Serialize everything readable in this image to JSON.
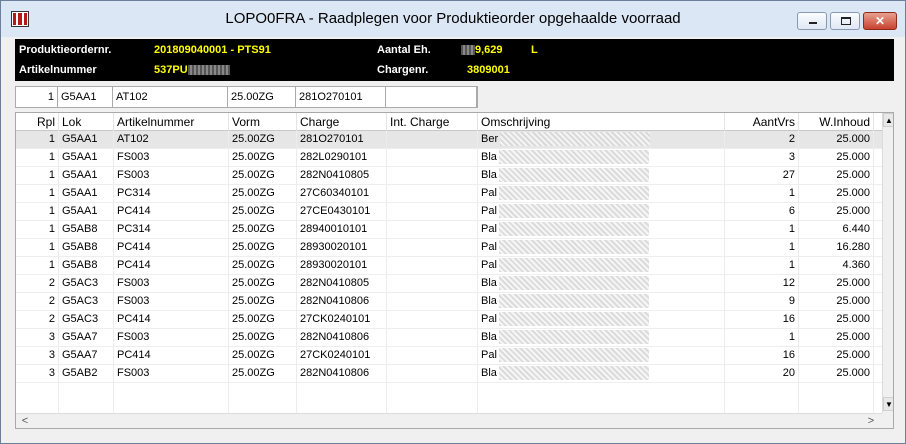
{
  "window": {
    "title": "LOPO0FRA - Raadplegen voor Produktieorder opgehaalde voorraad",
    "min_glyph": "",
    "max_glyph": "",
    "close_glyph": "✕"
  },
  "header": {
    "order_label": "Produktieordernr.",
    "order_value": "201809040001 - PTS91",
    "article_label": "Artikelnummer",
    "article_value": "537PU",
    "qty_label": "Aantal Eh.",
    "qty_value": "9,629",
    "qty_unit": "L",
    "batch_label": "Chargenr.",
    "batch_value": "3809001"
  },
  "selection": {
    "rpl": "1",
    "lok": "G5AA1",
    "artikel": "AT102",
    "vorm": "25.00ZG",
    "charge": "281O270101",
    "extra": ""
  },
  "table": {
    "headers": [
      "Rpl",
      "Lok",
      "Artikelnummer",
      "Vorm",
      "Charge",
      "Int. Charge",
      "Omschrijving",
      "AantVrs",
      "W.Inhoud"
    ],
    "rows": [
      {
        "rpl": "1",
        "lok": "G5AA1",
        "artikel": "AT102",
        "vorm": "25.00ZG",
        "charge": "281O270101",
        "int": "",
        "oms": "Ber",
        "aant": "2",
        "inh": "25.000"
      },
      {
        "rpl": "1",
        "lok": "G5AA1",
        "artikel": "FS003",
        "vorm": "25.00ZG",
        "charge": "282L0290101",
        "int": "",
        "oms": "Bla",
        "aant": "3",
        "inh": "25.000"
      },
      {
        "rpl": "1",
        "lok": "G5AA1",
        "artikel": "FS003",
        "vorm": "25.00ZG",
        "charge": "282N0410805",
        "int": "",
        "oms": "Bla",
        "aant": "27",
        "inh": "25.000"
      },
      {
        "rpl": "1",
        "lok": "G5AA1",
        "artikel": "PC314",
        "vorm": "25.00ZG",
        "charge": "27C60340101",
        "int": "",
        "oms": "Pal",
        "aant": "1",
        "inh": "25.000"
      },
      {
        "rpl": "1",
        "lok": "G5AA1",
        "artikel": "PC414",
        "vorm": "25.00ZG",
        "charge": "27CE0430101",
        "int": "",
        "oms": "Pal",
        "aant": "6",
        "inh": "25.000"
      },
      {
        "rpl": "1",
        "lok": "G5AB8",
        "artikel": "PC314",
        "vorm": "25.00ZG",
        "charge": "28940010101",
        "int": "",
        "oms": "Pal",
        "aant": "1",
        "inh": "6.440"
      },
      {
        "rpl": "1",
        "lok": "G5AB8",
        "artikel": "PC414",
        "vorm": "25.00ZG",
        "charge": "28930020101",
        "int": "",
        "oms": "Pal",
        "aant": "1",
        "inh": "16.280"
      },
      {
        "rpl": "1",
        "lok": "G5AB8",
        "artikel": "PC414",
        "vorm": "25.00ZG",
        "charge": "28930020101",
        "int": "",
        "oms": "Pal",
        "aant": "1",
        "inh": "4.360"
      },
      {
        "rpl": "2",
        "lok": "G5AC3",
        "artikel": "FS003",
        "vorm": "25.00ZG",
        "charge": "282N0410805",
        "int": "",
        "oms": "Bla",
        "aant": "12",
        "inh": "25.000"
      },
      {
        "rpl": "2",
        "lok": "G5AC3",
        "artikel": "FS003",
        "vorm": "25.00ZG",
        "charge": "282N0410806",
        "int": "",
        "oms": "Bla",
        "aant": "9",
        "inh": "25.000"
      },
      {
        "rpl": "2",
        "lok": "G5AC3",
        "artikel": "PC414",
        "vorm": "25.00ZG",
        "charge": "27CK0240101",
        "int": "",
        "oms": "Pal",
        "aant": "16",
        "inh": "25.000"
      },
      {
        "rpl": "3",
        "lok": "G5AA7",
        "artikel": "FS003",
        "vorm": "25.00ZG",
        "charge": "282N0410806",
        "int": "",
        "oms": "Bla",
        "aant": "1",
        "inh": "25.000"
      },
      {
        "rpl": "3",
        "lok": "G5AA7",
        "artikel": "PC414",
        "vorm": "25.00ZG",
        "charge": "27CK0240101",
        "int": "",
        "oms": "Pal",
        "aant": "16",
        "inh": "25.000"
      },
      {
        "rpl": "3",
        "lok": "G5AB2",
        "artikel": "FS003",
        "vorm": "25.00ZG",
        "charge": "282N0410806",
        "int": "",
        "oms": "Bla",
        "aant": "20",
        "inh": "25.000"
      }
    ]
  },
  "scroll": {
    "up": "▲",
    "down": "▼",
    "left": "<",
    "right": ">"
  },
  "colors": {
    "header_bg": "#000000",
    "header_label": "#ffffff",
    "header_value": "#ffff00",
    "selected_row": "#e6e6e6",
    "app_icon": "#b51a1a"
  }
}
